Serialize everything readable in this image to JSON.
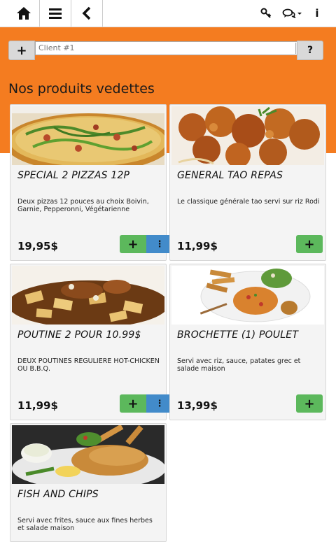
{
  "header": {
    "home_icon": "home-icon",
    "menu_icon": "hamburger-icon",
    "back_icon": "chevron-left-icon",
    "key_icon": "key-icon",
    "chat_icon": "chat-bubbles-icon",
    "info_icon": "info-icon",
    "info_label": "i"
  },
  "client_bar": {
    "add_label": "+",
    "select_value": "Client #1",
    "help_label": "?"
  },
  "section_title": "Nos produits vedettes",
  "products": [
    {
      "name": "SPECIAL 2 PIZZAS 12P",
      "description": "Deux pizzas 12 pouces au choix Boivin, Garnie, Pepperonni, Végétarienne",
      "price": "19,95$",
      "add": "+",
      "more": "⋮"
    },
    {
      "name": "GENERAL TAO REPAS",
      "description": "Le classique générale tao servi sur riz Rodi",
      "price": "11,99$",
      "add": "+"
    },
    {
      "name": "POUTINE 2 POUR 10.99$",
      "description": "DEUX POUTINES REGULIERE HOT-CHICKEN OU B.B.Q.",
      "price": "11,99$",
      "add": "+",
      "more": "⋮"
    },
    {
      "name": "BROCHETTE (1) POULET",
      "description": "Servi avec riz, sauce, patates grec et salade maison",
      "price": "13,99$",
      "add": "+"
    },
    {
      "name": "FISH AND CHIPS",
      "description": "Servi avec frites, sauce aux fines herbes et salade maison"
    }
  ],
  "colors": {
    "accent": "#f47c20",
    "add_button": "#5cb85c",
    "more_button": "#428bca"
  }
}
